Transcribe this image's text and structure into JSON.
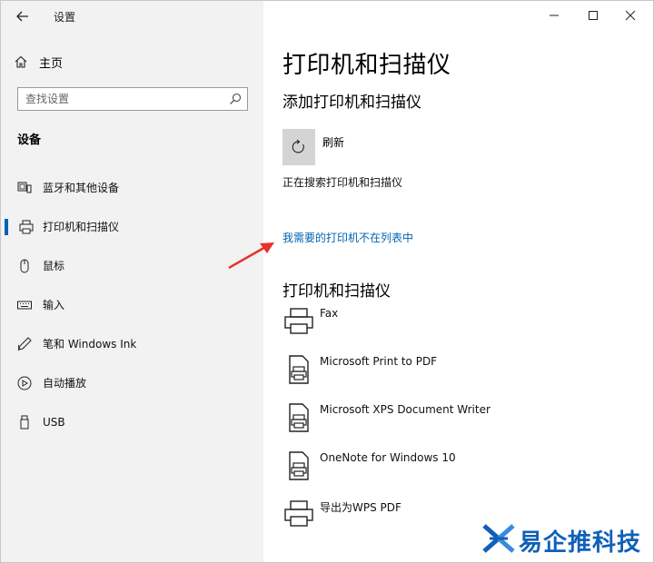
{
  "window": {
    "title": "设置",
    "controls": {
      "minimize": "minimize-icon",
      "maximize": "maximize-icon",
      "close": "close-icon"
    }
  },
  "sidebar": {
    "home_label": "主页",
    "search": {
      "placeholder": "查找设置",
      "value": ""
    },
    "section_title": "设备",
    "items": [
      {
        "label": "蓝牙和其他设备",
        "icon": "bluetooth-devices-icon",
        "active": false
      },
      {
        "label": "打印机和扫描仪",
        "icon": "printer-icon",
        "active": true
      },
      {
        "label": "鼠标",
        "icon": "mouse-icon",
        "active": false
      },
      {
        "label": "输入",
        "icon": "keyboard-icon",
        "active": false
      },
      {
        "label": "笔和 Windows Ink",
        "icon": "pen-icon",
        "active": false
      },
      {
        "label": "自动播放",
        "icon": "autoplay-icon",
        "active": false
      },
      {
        "label": "USB",
        "icon": "usb-icon",
        "active": false
      }
    ]
  },
  "main": {
    "page_title": "打印机和扫描仪",
    "add_section_title": "添加打印机和扫描仪",
    "refresh_label": "刷新",
    "searching_text": "正在搜索打印机和扫描仪",
    "not_listed_link": "我需要的打印机不在列表中",
    "printers_section_title": "打印机和扫描仪",
    "printers": [
      {
        "name": "Fax",
        "icon": "fax-printer-icon"
      },
      {
        "name": "Microsoft Print to PDF",
        "icon": "pdf-printer-icon"
      },
      {
        "name": "Microsoft XPS Document Writer",
        "icon": "xps-printer-icon"
      },
      {
        "name": "OneNote for Windows 10",
        "icon": "onenote-printer-icon"
      },
      {
        "name": "导出为WPS PDF",
        "icon": "wps-printer-icon"
      }
    ]
  },
  "colors": {
    "accent": "#0063b1",
    "annotation": "#e8312a",
    "watermark": "#1060b8"
  },
  "watermark": {
    "text": "易企推科技"
  }
}
